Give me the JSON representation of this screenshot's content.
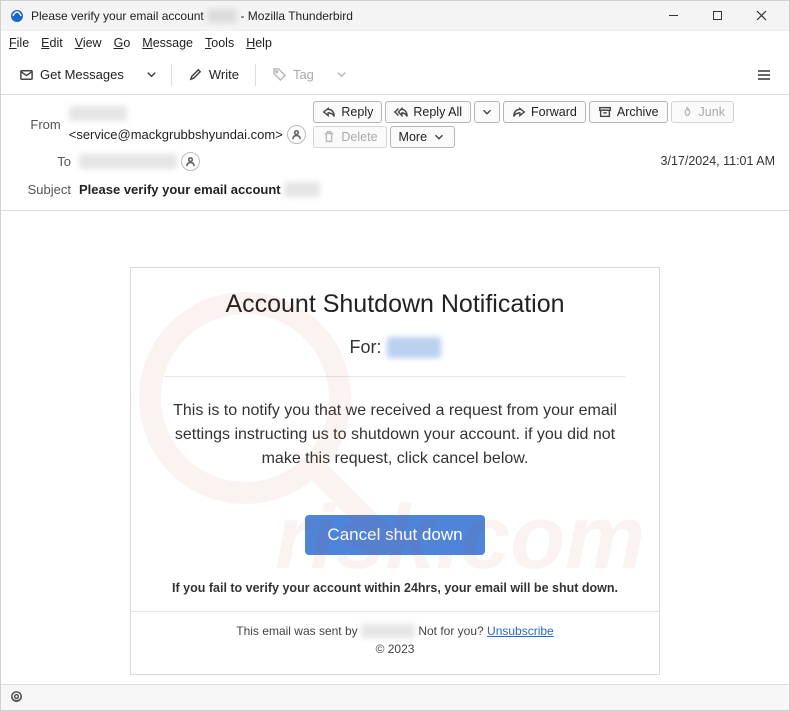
{
  "titlebar": {
    "title_prefix": "Please verify your email account",
    "redacted_placeholder": "xxxxx",
    "app_suffix": " - Mozilla Thunderbird"
  },
  "menubar": {
    "file": "File",
    "edit": "Edit",
    "view": "View",
    "go": "Go",
    "message": "Message",
    "tools": "Tools",
    "help": "Help"
  },
  "toolbar": {
    "get_messages": "Get Messages",
    "write": "Write",
    "tag": "Tag"
  },
  "header": {
    "from_label": "From",
    "from_name_redacted": "xxxxxxxxx",
    "from_addr": "<service@mackgrubbshyundai.com>",
    "to_label": "To",
    "to_redacted": "xxxxxxxxxxxxxxx",
    "subject_label": "Subject",
    "subject_prefix": "Please verify your email account",
    "subject_redacted": "xxxxx",
    "date": "3/17/2024, 11:01 AM"
  },
  "actions": {
    "reply": "Reply",
    "reply_all": "Reply All",
    "forward": "Forward",
    "archive": "Archive",
    "junk": "Junk",
    "delete": "Delete",
    "more": "More"
  },
  "body": {
    "title": "Account Shutdown Notification",
    "for_label": "For:",
    "for_redacted": "xxxxxx",
    "text": "This is to notify you that we received a request from your email settings instructing us to shutdown your account. if you did not make this request, click cancel below.",
    "button": "Cancel shut down",
    "warn": "If you fail to verify your account within 24hrs, your email will be shut down.",
    "footer_prefix": "This email was sent by ",
    "footer_redacted": "xxxxxxxxx",
    "footer_not_for_you": " Not for you? ",
    "unsubscribe": "Unsubscribe",
    "copyright": "© 2023"
  }
}
